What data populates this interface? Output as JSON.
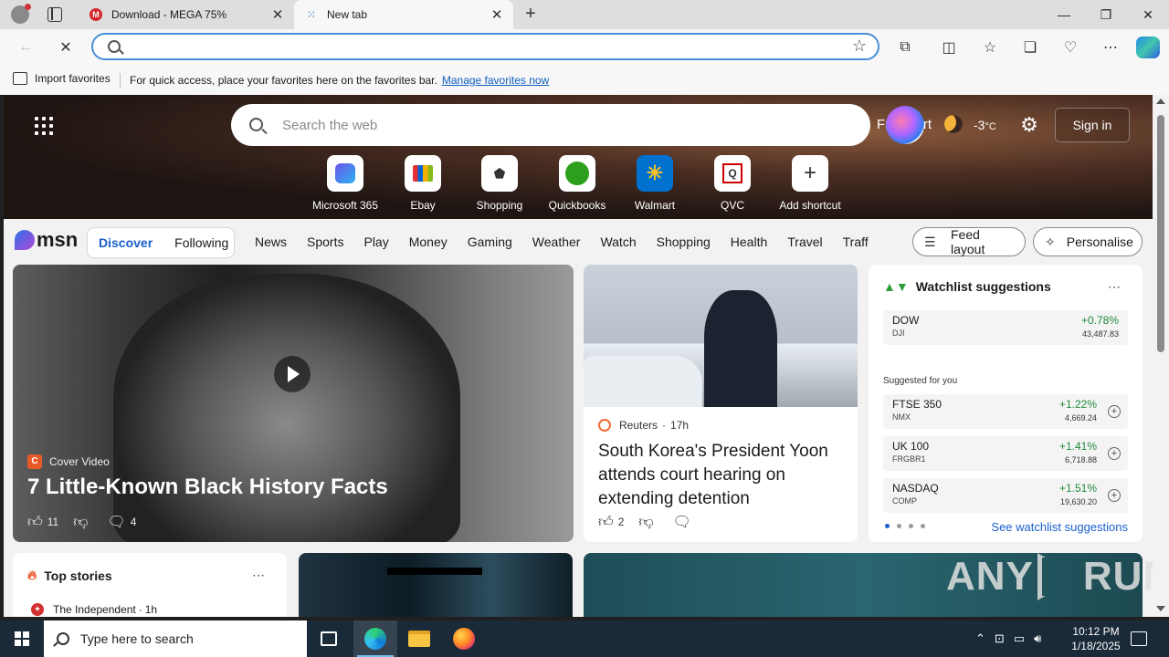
{
  "tabs": [
    {
      "label": "Download - MEGA 75%",
      "icon": "mega-icon"
    },
    {
      "label": "New tab",
      "icon": "loading-icon"
    }
  ],
  "window_controls": {
    "minimize": "—",
    "restore": "❐",
    "close": "✕"
  },
  "address_bar": {
    "value": "",
    "placeholder": ""
  },
  "favorites_bar": {
    "import_label": "Import favorites",
    "message": "For quick access, place your favorites here on the favorites bar.",
    "link": "Manage favorites now"
  },
  "hero": {
    "search_placeholder": "Search the web",
    "location": "Frankfurt",
    "temperature": "-3",
    "temperature_unit": "°C",
    "signin_label": "Sign in",
    "shortcuts": [
      {
        "label": "Microsoft 365",
        "icon": "microsoft365-icon"
      },
      {
        "label": "Ebay",
        "icon": "ebay-icon"
      },
      {
        "label": "Shopping",
        "icon": "shopping-tag-icon"
      },
      {
        "label": "Quickbooks",
        "icon": "quickbooks-icon"
      },
      {
        "label": "Walmart",
        "icon": "walmart-icon"
      },
      {
        "label": "QVC",
        "icon": "qvc-icon"
      },
      {
        "label": "Add shortcut",
        "icon": "plus-icon"
      }
    ]
  },
  "msn": {
    "logo": "msn",
    "feed_tabs": [
      "Discover",
      "Following"
    ],
    "nav": [
      "News",
      "Sports",
      "Play",
      "Money",
      "Gaming",
      "Weather",
      "Watch",
      "Shopping",
      "Health",
      "Travel",
      "Traffic"
    ],
    "feed_layout_label": "Feed layout",
    "personalise_label": "Personalise"
  },
  "hero_card": {
    "source": "Cover Video",
    "source_logo": "C",
    "title": "7 Little-Known Black History Facts",
    "likes": "11",
    "comments": "4"
  },
  "news_card": {
    "source": "Reuters",
    "age": "17h",
    "title": "South Korea's President Yoon attends court hearing on extending detention",
    "likes": "2"
  },
  "watchlist": {
    "title": "Watchlist suggestions",
    "pinned": [
      {
        "symbol": "DOW",
        "exchange": "DJI",
        "change": "+0.78%",
        "price": "43,487.83"
      }
    ],
    "suggested_label": "Suggested for you",
    "suggested": [
      {
        "symbol": "FTSE 350",
        "exchange": "NMX",
        "change": "+1.22%",
        "price": "4,669.24"
      },
      {
        "symbol": "UK 100",
        "exchange": "FRGBR1",
        "change": "+1.41%",
        "price": "6,718.88"
      },
      {
        "symbol": "NASDAQ",
        "exchange": "COMP",
        "change": "+1.51%",
        "price": "19,630.20"
      }
    ],
    "link": "See watchlist suggestions"
  },
  "top_stories": {
    "title": "Top stories",
    "source": "The Independent",
    "age": "1h"
  },
  "watermark": {
    "left": "ANY",
    "right": "RUN"
  },
  "taskbar": {
    "search_placeholder": "Type here to search",
    "time": "10:12 PM",
    "date": "1/18/2025"
  },
  "colors": {
    "accent": "#1a5fcc",
    "positive": "#1f8a3b",
    "taskbar": "#1b2a39"
  }
}
